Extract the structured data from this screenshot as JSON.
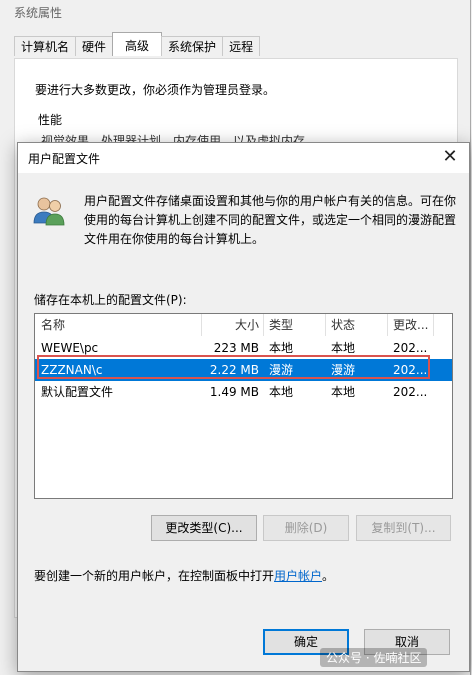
{
  "background_window": {
    "title": "系统属性",
    "tabs": [
      {
        "label": "计算机名"
      },
      {
        "label": "硬件"
      },
      {
        "label": "高级"
      },
      {
        "label": "系统保护"
      },
      {
        "label": "远程"
      }
    ],
    "active_tab": "高级",
    "admin_note": "要进行大多数更改，你必须作为管理员登录。",
    "performance_group": "性能",
    "performance_desc": "视觉效果，处理器计划，内存使用，以及虚拟内存"
  },
  "dialog": {
    "title": "用户配置文件",
    "close_glyph": "✕",
    "intro": "用户配置文件存储桌面设置和其他与你的用户帐户有关的信息。可在你使用的每台计算机上创建不同的配置文件，或选定一个相同的漫游配置文件用在你使用的每台计算机上。",
    "list_label": "储存在本机上的配置文件(P):",
    "columns": {
      "name": "名称",
      "size": "大小",
      "type": "类型",
      "status": "状态",
      "modified": "更改..."
    },
    "profiles": [
      {
        "name": "WEWE\\pc",
        "size": "223 MB",
        "type": "本地",
        "status": "本地",
        "modified": "202..."
      },
      {
        "name": "ZZZNAN\\c",
        "size": "2.22 MB",
        "type": "漫游",
        "status": "漫游",
        "modified": "202..."
      },
      {
        "name": "默认配置文件",
        "size": "1.49 MB",
        "type": "本地",
        "status": "本地",
        "modified": "202..."
      }
    ],
    "selected_index": 1,
    "buttons": {
      "change_type": "更改类型(C)...",
      "delete": "删除(D)",
      "copy_to": "复制到(T)...",
      "ok": "确定",
      "cancel": "取消"
    },
    "footer_text": "要创建一个新的用户帐户，在控制面板中打开",
    "footer_link": "用户帐户",
    "footer_period": "。"
  },
  "watermark": "公众号 · 佐喃社区",
  "colors": {
    "selection": "#0078d7",
    "highlight_box": "#d9534f",
    "link": "#0066cc"
  }
}
